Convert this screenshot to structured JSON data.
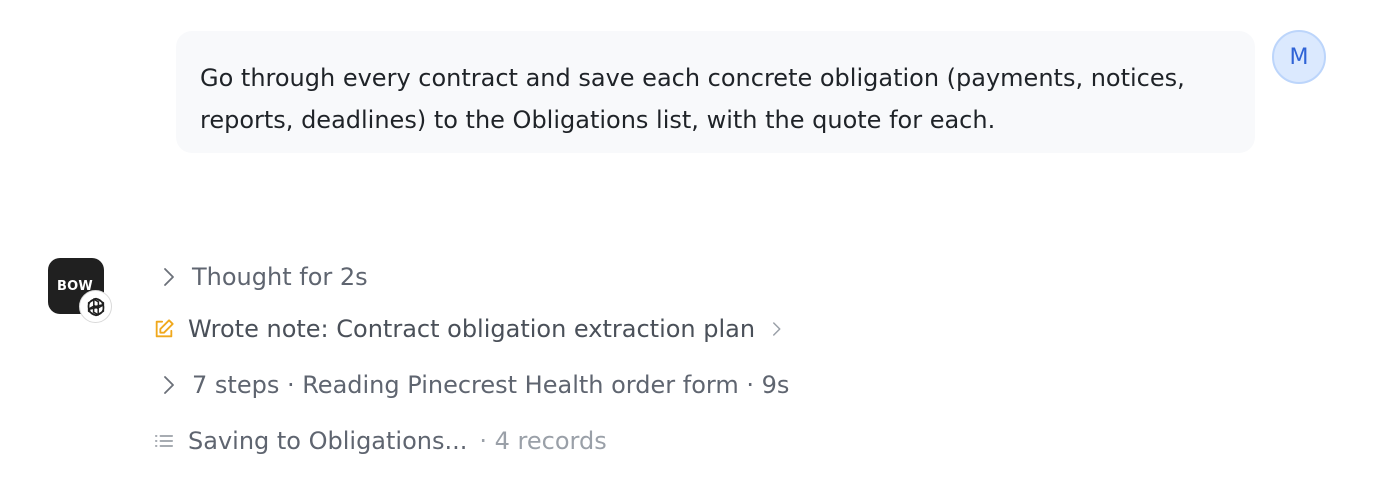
{
  "user_message": {
    "text": "Go through every contract and save each concrete obligation (payments, notices, reports, deadlines) to the Obligations list, with the quote for each.",
    "avatar_initial": "M"
  },
  "assistant": {
    "avatar_text": "BOW",
    "badge_icon": "openai-logo-icon",
    "steps": {
      "thought": {
        "label": "Thought for 2s",
        "icon": "chevron-right-icon"
      },
      "note": {
        "label": "Wrote note: Contract obligation extraction plan",
        "icon": "pencil-edit-icon",
        "icon_color": "#f0a81c"
      },
      "reading": {
        "label": "7 steps · Reading Pinecrest Health order form · 9s",
        "icon": "chevron-right-icon"
      },
      "saving": {
        "label": "Saving to Obligations...",
        "count": "· 4 records",
        "icon": "list-icon"
      }
    }
  },
  "colors": {
    "bubble_bg": "#f8f9fb",
    "user_avatar_bg": "#dbe9fe",
    "user_avatar_fg": "#2f63d6",
    "assistant_avatar_bg": "#202020",
    "step_text": "#5f6570",
    "muted_text": "#9aa0a8"
  }
}
